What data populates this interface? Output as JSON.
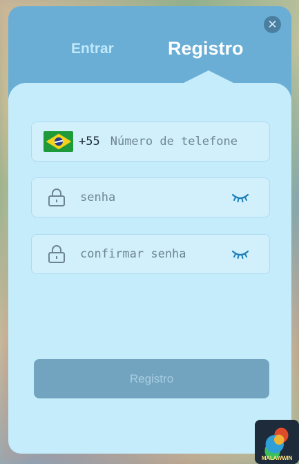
{
  "modal": {
    "close_icon": "close-icon",
    "tabs": [
      {
        "label": "Entrar",
        "active": false
      },
      {
        "label": "Registro",
        "active": true
      }
    ]
  },
  "form": {
    "phone": {
      "flag_icon": "brazil-flag-icon",
      "country_code": "+55",
      "placeholder": "Número de telefone",
      "value": ""
    },
    "password": {
      "lock_icon": "lock-icon",
      "placeholder": "senha",
      "value": "",
      "toggle_icon": "eye-closed-icon"
    },
    "confirm_password": {
      "lock_icon": "lock-icon",
      "placeholder": "confirmar senha",
      "value": "",
      "toggle_icon": "eye-closed-icon"
    },
    "submit_label": "Registro"
  },
  "app_badge": {
    "brand": "MALAWWIN"
  },
  "colors": {
    "header": "#6aaed6",
    "panel": "#c5ecfb",
    "field": "#d1f0fc",
    "submit_disabled": "#72a4c0",
    "eye_icon": "#1d7fb8"
  }
}
